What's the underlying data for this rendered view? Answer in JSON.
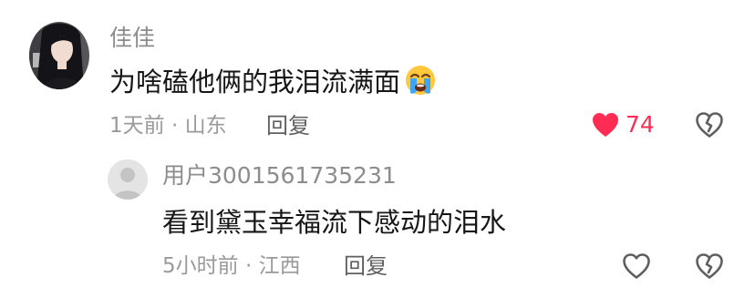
{
  "comments": [
    {
      "username": "佳佳",
      "text": "为啥磕他俩的我泪流满面",
      "emoji": "loudly-crying-face-emoji",
      "time_location": "1天前 · 山东",
      "reply_label": "回复",
      "likes": "74",
      "liked": true
    }
  ],
  "replies": [
    {
      "username": "用户3001561735231",
      "text": "看到黛玉幸福流下感动的泪水",
      "time_location": "5小时前 · 江西",
      "reply_label": "回复",
      "liked": false
    }
  ],
  "colors": {
    "like_active": "#fe2c55",
    "username": "#8c8c8c",
    "meta": "#9a9a9a",
    "text": "#161616"
  },
  "icons": {
    "like_active": "heart-filled-icon",
    "like": "heart-outline-icon",
    "dislike": "broken-heart-icon"
  }
}
